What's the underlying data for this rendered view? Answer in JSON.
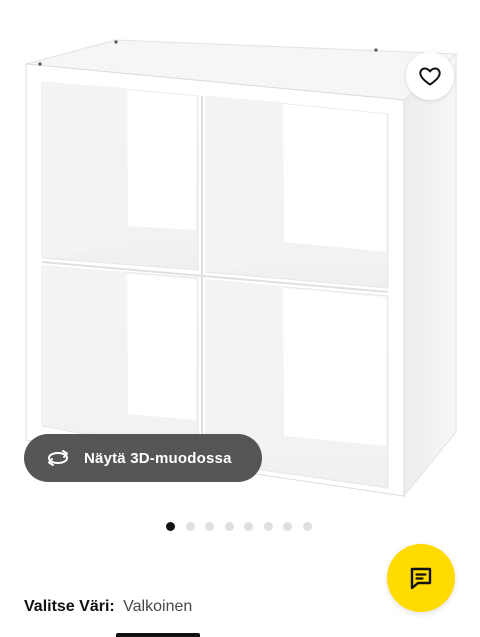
{
  "product_image": {
    "alt": "",
    "shelf_color": "#ffffff"
  },
  "favourite": {
    "icon": "heart-icon"
  },
  "view_3d": {
    "label": "Näytä 3D-muodossa",
    "icon": "rotate-3d-icon"
  },
  "carousel": {
    "count": 8,
    "active_index": 0
  },
  "chat": {
    "icon": "chat-bubble-icon",
    "color": "#ffdb00"
  },
  "colour": {
    "label": "Valitse Väri:",
    "value": "Valkoinen"
  },
  "colors": {
    "brand_yellow": "#ffdb00",
    "dark_text": "#111111",
    "overlay_grey": "#484848"
  }
}
